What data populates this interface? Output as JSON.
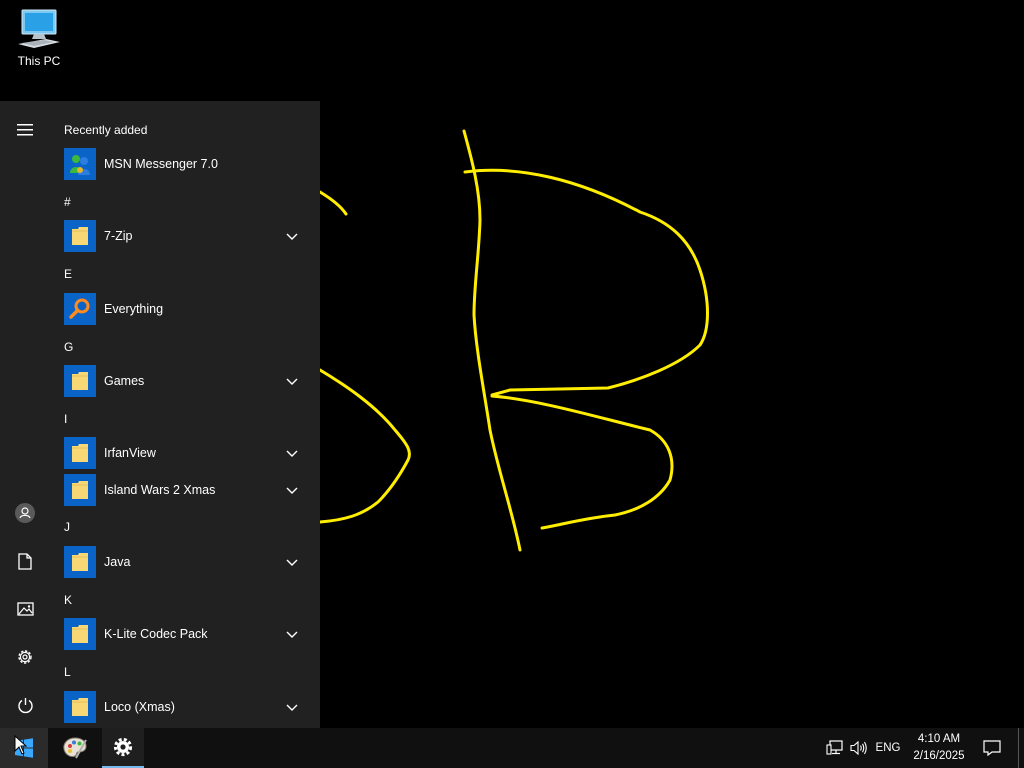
{
  "desktop": {
    "icons": [
      {
        "label": "This PC",
        "icon": "this-pc-icon"
      }
    ],
    "drawing": {
      "stroke_color": "#ffee00"
    }
  },
  "start_menu": {
    "rail": [
      {
        "name": "expand-menu",
        "icon": "hamburger-icon"
      },
      {
        "name": "user-account",
        "icon": "user-icon"
      },
      {
        "name": "documents",
        "icon": "document-icon"
      },
      {
        "name": "pictures",
        "icon": "pictures-icon"
      },
      {
        "name": "settings",
        "icon": "gear-icon"
      },
      {
        "name": "power",
        "icon": "power-icon"
      }
    ],
    "sections": [
      {
        "header": "Recently added",
        "items": [
          {
            "label": "MSN Messenger 7.0",
            "icon": "msn-messenger-icon",
            "expandable": false
          }
        ]
      },
      {
        "header": "#",
        "items": [
          {
            "label": "7-Zip",
            "icon": "folder-icon",
            "expandable": true
          }
        ]
      },
      {
        "header": "E",
        "items": [
          {
            "label": "Everything",
            "icon": "search-icon",
            "expandable": false
          }
        ]
      },
      {
        "header": "G",
        "items": [
          {
            "label": "Games",
            "icon": "folder-icon",
            "expandable": true
          }
        ]
      },
      {
        "header": "I",
        "items": [
          {
            "label": "IrfanView",
            "icon": "folder-icon",
            "expandable": true
          },
          {
            "label": "Island Wars 2 Xmas",
            "icon": "folder-icon",
            "expandable": true
          }
        ]
      },
      {
        "header": "J",
        "items": [
          {
            "label": "Java",
            "icon": "folder-icon",
            "expandable": true
          }
        ]
      },
      {
        "header": "K",
        "items": [
          {
            "label": "K-Lite Codec Pack",
            "icon": "folder-icon",
            "expandable": true
          }
        ]
      },
      {
        "header": "L",
        "items": [
          {
            "label": "Loco (Xmas)",
            "icon": "folder-icon",
            "expandable": true
          }
        ]
      }
    ]
  },
  "taskbar": {
    "apps": [
      {
        "name": "start",
        "icon": "windows-icon"
      },
      {
        "name": "paint",
        "icon": "paint-palette-icon"
      },
      {
        "name": "settings",
        "icon": "gear-icon",
        "active": true
      }
    ],
    "tray": {
      "language": "ENG",
      "time": "4:10 AM",
      "date": "2/16/2025",
      "icons": [
        "network-icon",
        "volume-icon",
        "notifications-icon"
      ]
    }
  },
  "colors": {
    "accent": "#0a64c8",
    "start_bg": "#212121",
    "taskbar_bg": "#101010",
    "folder": "#f8d775"
  }
}
